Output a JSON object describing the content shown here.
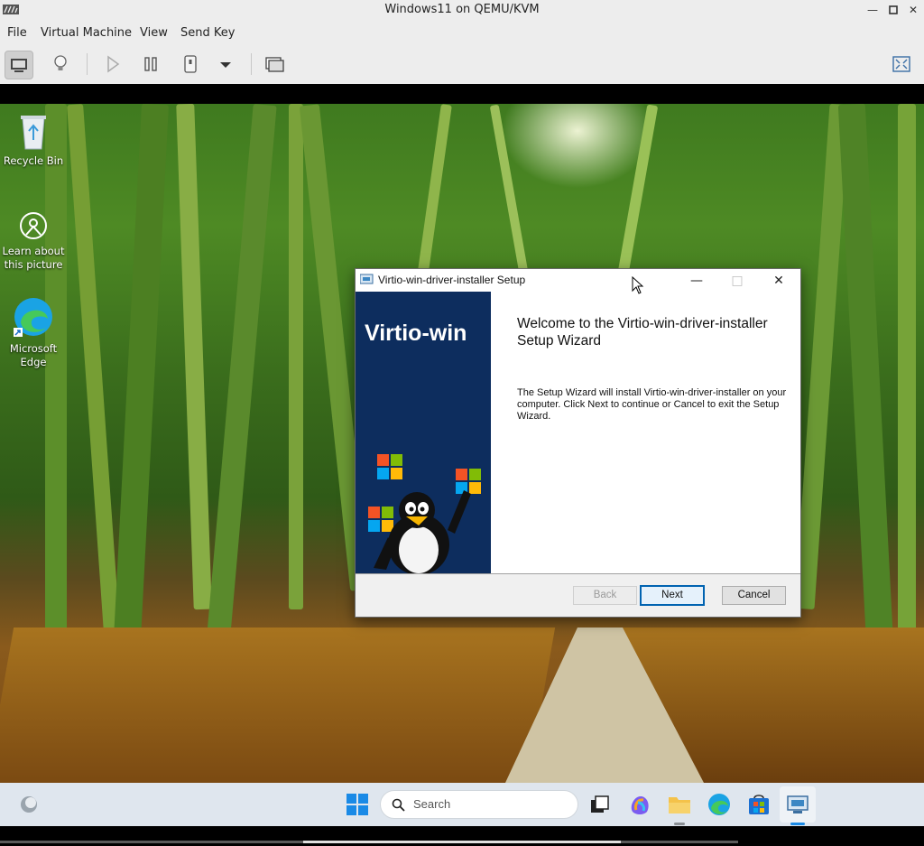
{
  "host": {
    "title": "Windows11 on QEMU/KVM",
    "menu": [
      "File",
      "Virtual Machine",
      "View",
      "Send Key"
    ]
  },
  "desktop": {
    "icons": [
      {
        "label_lines": [
          "Recycle Bin"
        ]
      },
      {
        "label_lines": [
          "Learn about",
          "this picture"
        ]
      },
      {
        "label_lines": [
          "Microsoft",
          "Edge"
        ]
      }
    ]
  },
  "dialog": {
    "title": "Virtio-win-driver-installer Setup",
    "brand": "Virtio-win",
    "heading": "Welcome to the Virtio-win-driver-installer Setup Wizard",
    "body": "The Setup Wizard will install Virtio-win-driver-installer on your computer. Click Next to continue or Cancel to exit the Setup Wizard.",
    "buttons": {
      "back": "Back",
      "next": "Next",
      "cancel": "Cancel"
    }
  },
  "taskbar": {
    "search_label": "Search"
  },
  "colors": {
    "banner": "#0d2d5e",
    "accent": "#0063b1"
  }
}
